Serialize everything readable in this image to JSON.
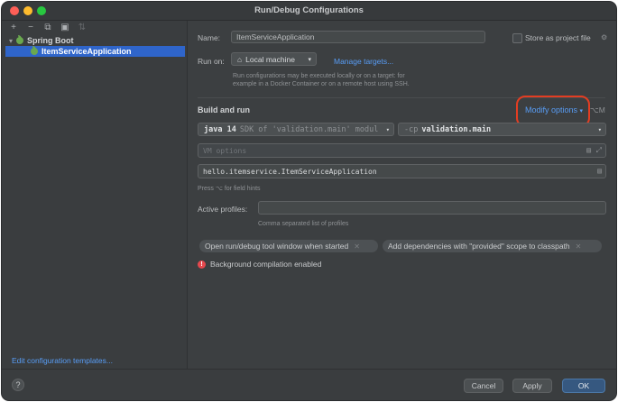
{
  "window": {
    "title": "Run/Debug Configurations"
  },
  "sidebar": {
    "toolbar": [
      "+",
      "−",
      "⧉",
      "▣",
      "⇅"
    ],
    "root_label": "Spring Boot",
    "selected_label": "ItemServiceApplication",
    "edit_templates": "Edit configuration templates..."
  },
  "form": {
    "name_label": "Name:",
    "name_value": "ItemServiceApplication",
    "store_label": "Store as project file",
    "run_on_label": "Run on:",
    "run_on_value": "Local machine",
    "manage_targets": "Manage targets...",
    "run_on_hint_1": "Run configurations may be executed locally or on a target: for",
    "run_on_hint_2": "example in a Docker Container or on a remote host using SSH.",
    "build_run_title": "Build and run",
    "modify_options": "Modify options",
    "modify_shortcut": "⌥M",
    "sdk_bold": "java 14",
    "sdk_dim": "SDK of 'validation.main' modul",
    "cp_flag": "-cp",
    "cp_value": "validation.main",
    "vm_options_placeholder": "VM options",
    "main_class": "hello.itemservice.ItemServiceApplication",
    "field_hint": "Press ⌥ for field hints",
    "profiles_label": "Active profiles:",
    "profiles_hint": "Comma separated list of profiles",
    "chip_1": "Open run/debug tool window when started",
    "chip_2": "Add dependencies with \"provided\" scope to classpath",
    "warning_text": "Background compilation enabled"
  },
  "footer": {
    "help": "?",
    "cancel": "Cancel",
    "apply": "Apply",
    "ok": "OK"
  }
}
